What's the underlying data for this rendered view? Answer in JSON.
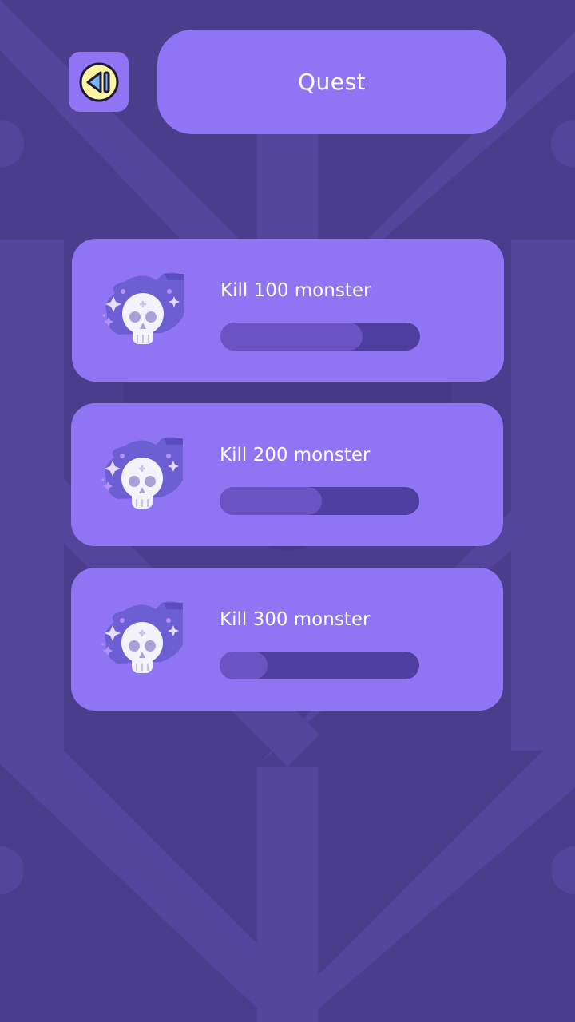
{
  "header": {
    "title": "Quest",
    "back_icon": "back-play-icon"
  },
  "colors": {
    "background": "#4a3d8c",
    "panel": "#8f75f3",
    "progress_track": "#4e3ea0",
    "progress_fill": "#6a54c4",
    "back_icon_fill": "#fdf3a0"
  },
  "quests": [
    {
      "label": "Kill 100 monster",
      "icon": "skull-icon",
      "progress": 0.71
    },
    {
      "label": "Kill 200 monster",
      "icon": "skull-icon",
      "progress": 0.51
    },
    {
      "label": "Kill 300 monster",
      "icon": "skull-icon",
      "progress": 0.24
    }
  ]
}
